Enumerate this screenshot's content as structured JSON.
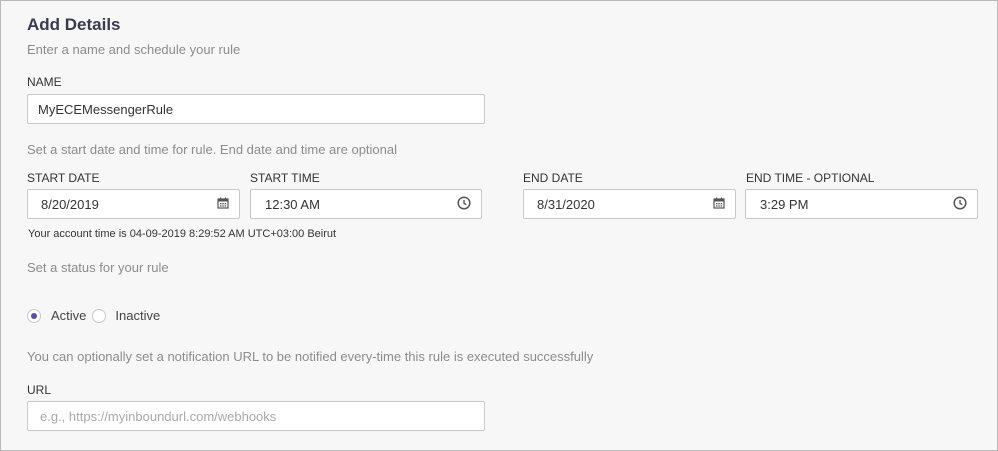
{
  "header": {
    "title": "Add Details",
    "subtitle": "Enter a name and schedule your rule"
  },
  "name": {
    "label": "NAME",
    "value": "MyECEMessengerRule"
  },
  "schedule": {
    "hint": "Set a start date and time for rule. End date and time are optional",
    "start_date_label": "START DATE",
    "start_date_value": "8/20/2019",
    "start_time_label": "START TIME",
    "start_time_value": "12:30 AM",
    "end_date_label": "END DATE",
    "end_date_value": "8/31/2020",
    "end_time_label": "END TIME - OPTIONAL",
    "end_time_value": "3:29 PM",
    "account_time": "Your account time is 04-09-2019 8:29:52 AM UTC+03:00 Beirut"
  },
  "status": {
    "hint": "Set a status for your rule",
    "options": [
      {
        "label": "Active",
        "selected": true
      },
      {
        "label": "Inactive",
        "selected": false
      }
    ]
  },
  "url": {
    "hint": "You can optionally set a notification URL to be notified every-time this rule is executed successfully",
    "label": "URL",
    "placeholder": "e.g., https://myinboundurl.com/webhooks"
  },
  "icons": {
    "date": "calendar-icon",
    "time": "clock-icon"
  },
  "colors": {
    "accent": "#5b4aa8",
    "title": "#3b3b4f",
    "hint": "#8c8c8c"
  }
}
